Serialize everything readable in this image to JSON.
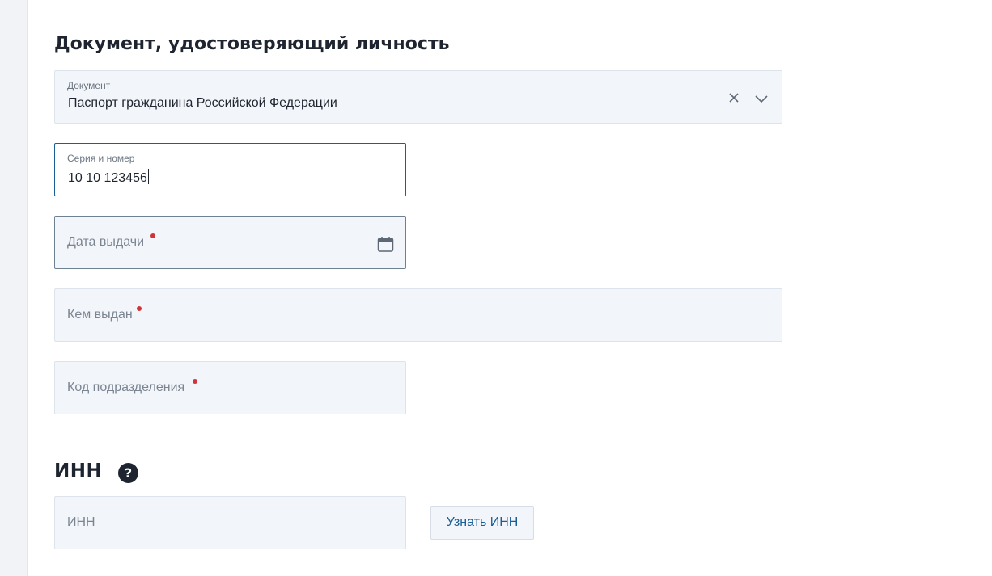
{
  "identity_section": {
    "title": "Документ, удостоверяющий личность",
    "document_type": {
      "label": "Документ",
      "value": "Паспорт гражданина Российской Федерации",
      "clear_icon": "close-icon",
      "dropdown_icon": "chevron-down-icon"
    },
    "series_number": {
      "label": "Серия и номер",
      "value": "10 10 123456"
    },
    "issue_date": {
      "placeholder": "Дата выдачи",
      "required": true,
      "icon": "calendar-icon"
    },
    "issued_by": {
      "placeholder": "Кем выдан",
      "required": true
    },
    "department_code": {
      "placeholder": "Код подразделения",
      "required": true
    }
  },
  "inn_section": {
    "title": "ИНН",
    "help_glyph": "?",
    "help_icon": "question-circle-icon",
    "field": {
      "placeholder": "ИНН"
    },
    "lookup_button": "Узнать ИНН"
  },
  "colors": {
    "accent": "#1a5e97",
    "required_dot": "#d0343a",
    "field_bg": "#f2f5f9",
    "text": "#1f2530"
  }
}
